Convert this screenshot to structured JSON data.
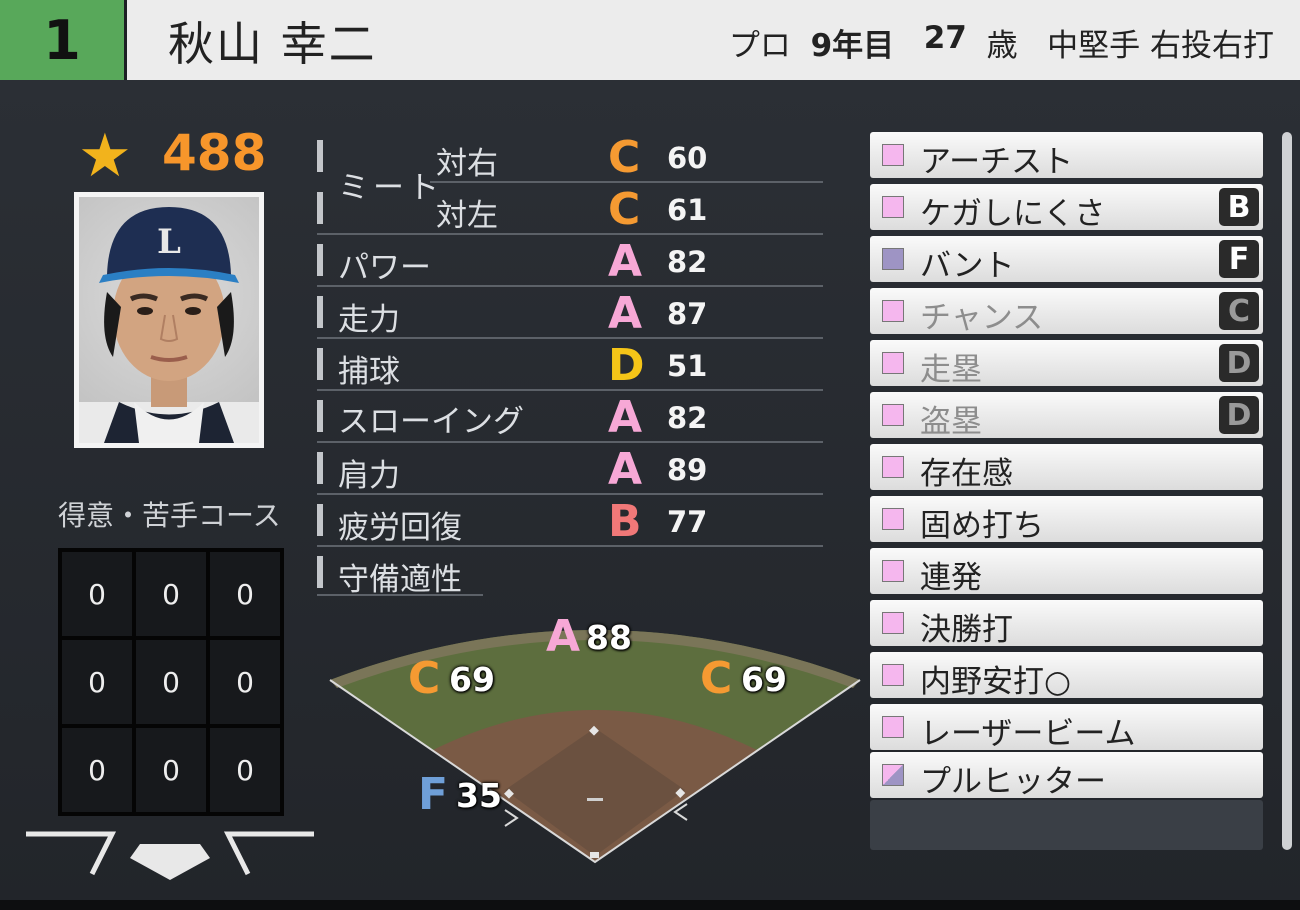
{
  "header": {
    "number": "1",
    "name": "秋山 幸二",
    "pro_label": "プロ",
    "years": "9年目",
    "age": "27",
    "age_unit": "歳",
    "position": "中堅手",
    "throw_bat": "右投右打"
  },
  "overall": {
    "icon": "star-icon",
    "value": "488"
  },
  "zone": {
    "title": "得意・苦手コース",
    "cells": [
      "0",
      "0",
      "0",
      "0",
      "0",
      "0",
      "0",
      "0",
      "0"
    ]
  },
  "stats": {
    "meet_label": "ミート",
    "meet_right_label": "対右",
    "meet_right_grade": "C",
    "meet_right_value": "60",
    "meet_left_label": "対左",
    "meet_left_grade": "C",
    "meet_left_value": "61",
    "power_label": "パワー",
    "power_grade": "A",
    "power_value": "82",
    "speed_label": "走力",
    "speed_grade": "A",
    "speed_value": "87",
    "catch_label": "捕球",
    "catch_grade": "D",
    "catch_value": "51",
    "throwing_label": "スローイング",
    "throwing_grade": "A",
    "throwing_value": "82",
    "arm_label": "肩力",
    "arm_grade": "A",
    "arm_value": "89",
    "recovery_label": "疲労回復",
    "recovery_grade": "B",
    "recovery_value": "77",
    "defense_label": "守備適性"
  },
  "fielding": {
    "center_grade": "A",
    "center_value": "88",
    "left_grade": "C",
    "left_value": "69",
    "right_grade": "C",
    "right_value": "69",
    "infield_grade": "F",
    "infield_value": "35"
  },
  "abilities": [
    {
      "label": "アーチスト",
      "rank": ""
    },
    {
      "label": "ケガしにくさ",
      "rank": "B"
    },
    {
      "label": "バント",
      "rank": "F"
    },
    {
      "label": "チャンス",
      "rank": "C"
    },
    {
      "label": "走塁",
      "rank": "D"
    },
    {
      "label": "盗塁",
      "rank": "D"
    },
    {
      "label": "存在感",
      "rank": ""
    },
    {
      "label": "固め打ち",
      "rank": ""
    },
    {
      "label": "連発",
      "rank": ""
    },
    {
      "label": "決勝打",
      "rank": ""
    },
    {
      "label": "内野安打○",
      "rank": ""
    },
    {
      "label": "レーザービーム",
      "rank": ""
    },
    {
      "label": "プルヒッター",
      "rank": ""
    }
  ],
  "colors": {
    "grade_A": "#f7a8d6",
    "grade_B": "#f07878",
    "grade_C": "#f59a32",
    "grade_D": "#f5c518",
    "grade_F": "#6f9fd8",
    "accent": "#58a85a",
    "marker_pink": "#f5b7ee",
    "marker_purple": "#9e94c4"
  }
}
